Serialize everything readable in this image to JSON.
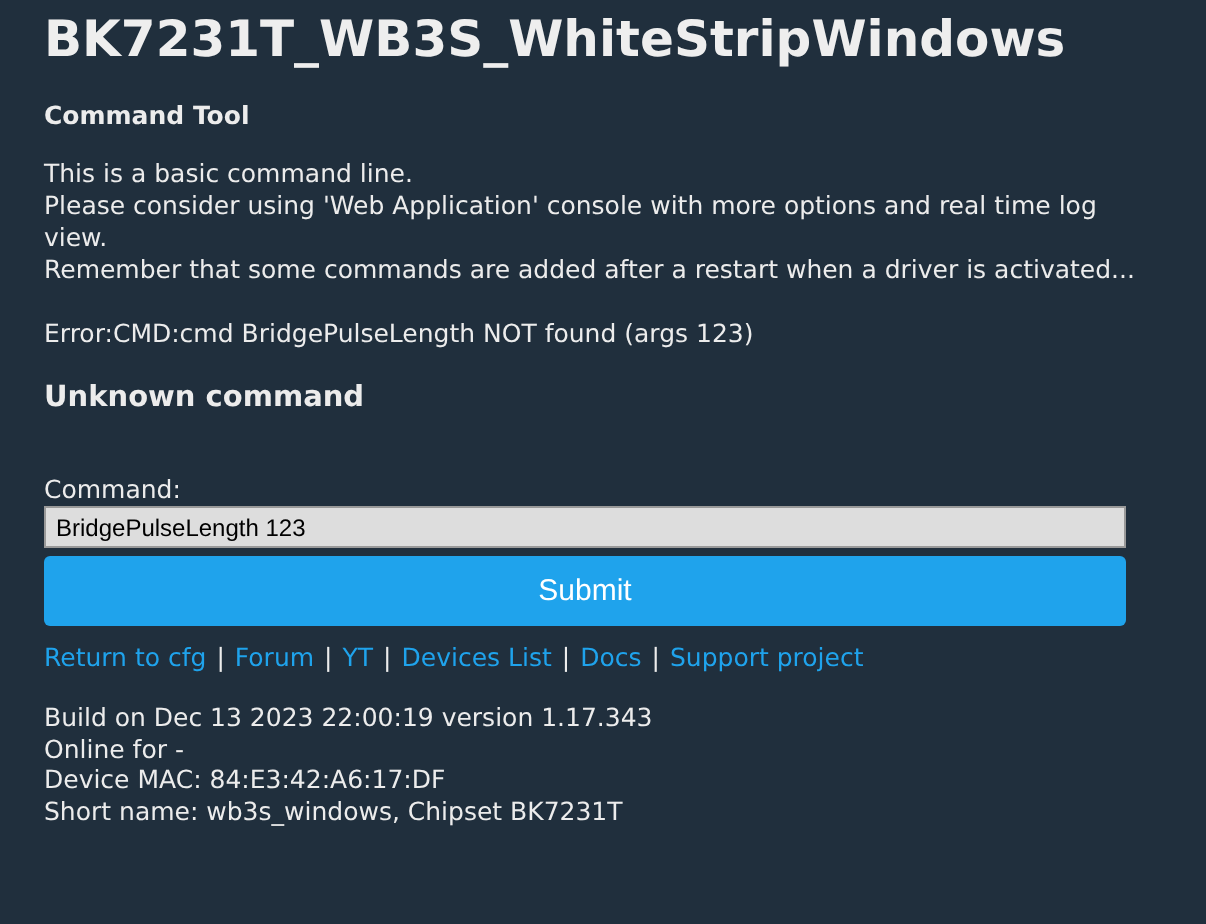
{
  "title": "BK7231T_WB3S_WhiteStripWindows",
  "section_title": "Command Tool",
  "intro_lines": [
    "This is a basic command line.",
    "Please consider using 'Web Application' console with more options and real time log view.",
    "Remember that some commands are added after a restart when a driver is activated..."
  ],
  "error": "Error:CMD:cmd BridgePulseLength NOT found (args 123)",
  "result_heading": "Unknown command",
  "command_form": {
    "label": "Command:",
    "value": "BridgePulseLength 123",
    "submit": "Submit"
  },
  "links": {
    "separator": "|",
    "items": [
      "Return to cfg",
      "Forum",
      "YT",
      "Devices List",
      "Docs",
      "Support project"
    ]
  },
  "info_lines": [
    "Build on Dec 13 2023 22:00:19 version 1.17.343",
    "Online for -",
    "Device MAC: 84:E3:42:A6:17:DF",
    "Short name: wb3s_windows, Chipset BK7231T"
  ]
}
